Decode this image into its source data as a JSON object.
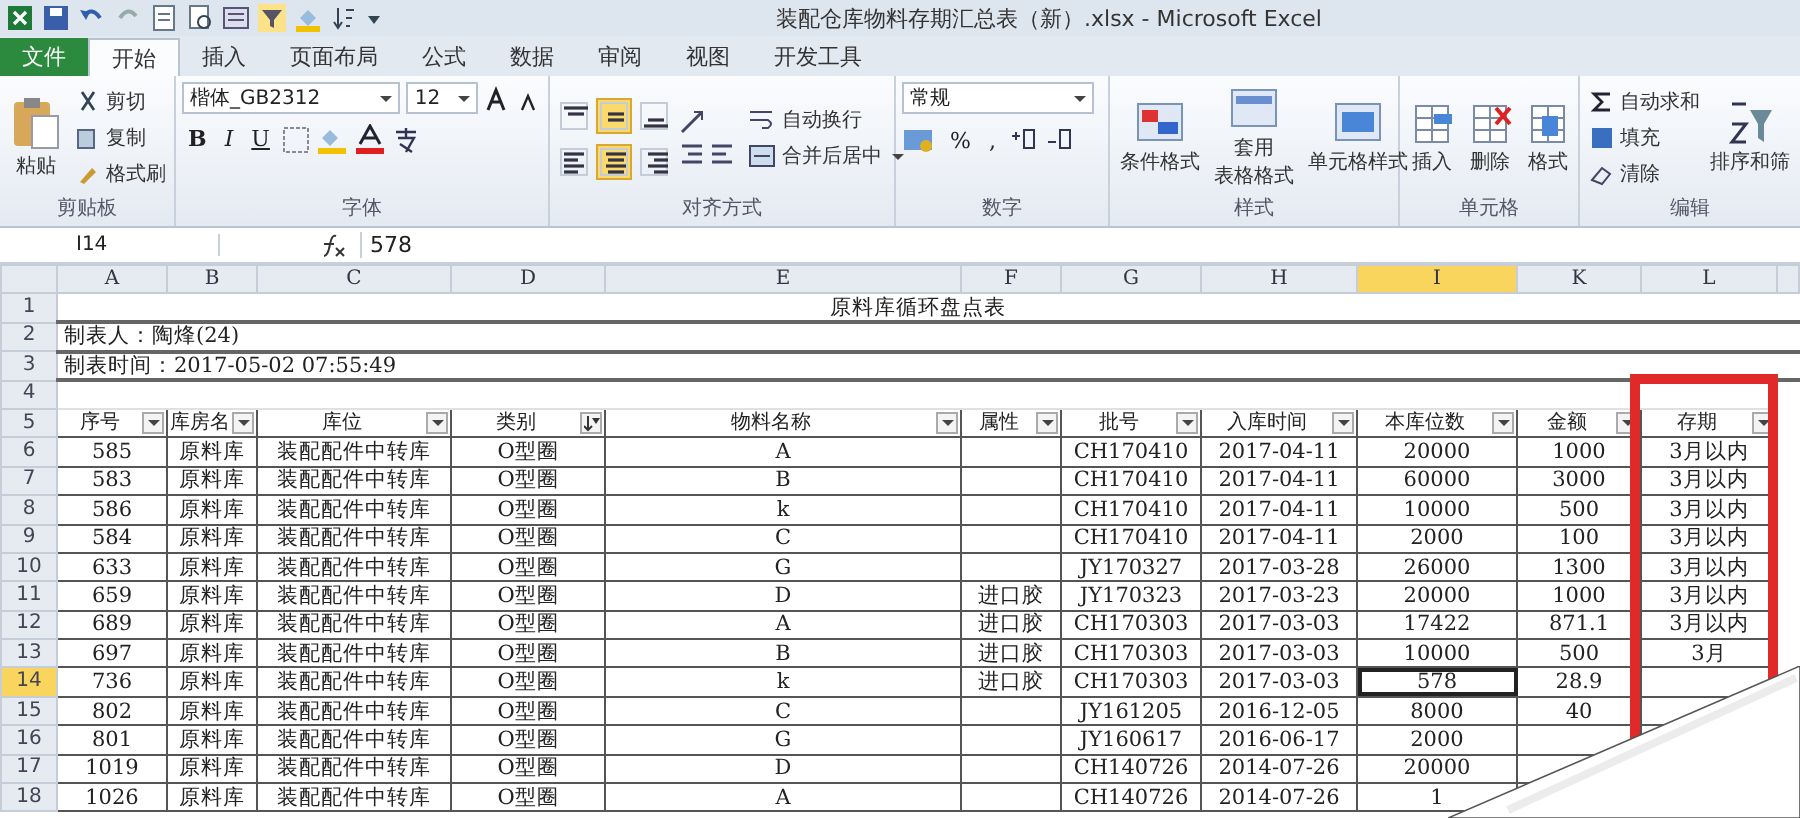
{
  "window": {
    "title": "装配仓库物料存期汇总表（新）.xlsx - Microsoft Excel"
  },
  "tabs": [
    {
      "label": "文件",
      "kind": "file",
      "selected": false
    },
    {
      "label": "开始",
      "kind": "tab",
      "selected": true
    },
    {
      "label": "插入",
      "kind": "tab",
      "selected": false
    },
    {
      "label": "页面布局",
      "kind": "tab",
      "selected": false
    },
    {
      "label": "公式",
      "kind": "tab",
      "selected": false
    },
    {
      "label": "数据",
      "kind": "tab",
      "selected": false
    },
    {
      "label": "审阅",
      "kind": "tab",
      "selected": false
    },
    {
      "label": "视图",
      "kind": "tab",
      "selected": false
    },
    {
      "label": "开发工具",
      "kind": "tab",
      "selected": false
    }
  ],
  "ribbon": {
    "clipboard": {
      "label": "剪贴板",
      "paste": "粘贴",
      "items": [
        "剪切",
        "复制",
        "格式刷"
      ]
    },
    "font": {
      "label": "字体",
      "family": "楷体_GB2312",
      "size": "12",
      "bold": "B",
      "italic": "I",
      "underline": "U"
    },
    "alignment": {
      "label": "对齐方式",
      "wrap": "自动换行",
      "merge": "合并后居中",
      "align": [
        {
          "kind": "top",
          "selected": false
        },
        {
          "kind": "middle",
          "selected": true
        },
        {
          "kind": "bottom",
          "selected": false
        },
        {
          "kind": "left",
          "selected": false
        },
        {
          "kind": "center",
          "selected": true
        },
        {
          "kind": "right",
          "selected": false
        }
      ]
    },
    "number": {
      "label": "数字",
      "format": "常规",
      "percent": "%",
      "comma": ","
    },
    "styles": {
      "label": "样式",
      "buttons": [
        [
          "条件格式"
        ],
        [
          "套用",
          "表格格式"
        ],
        [
          "单元格样式"
        ]
      ]
    },
    "cells": {
      "label": "单元格",
      "buttons": [
        "插入",
        "删除",
        "格式"
      ]
    },
    "editing": {
      "label": "编辑",
      "items": [
        "自动求和",
        "填充",
        "清除"
      ],
      "sort": "排序和筛"
    }
  },
  "formula_bar": {
    "name_box": "I14",
    "formula": "578"
  },
  "sheet": {
    "columns": [
      {
        "letter": "A",
        "selected": false
      },
      {
        "letter": "B",
        "selected": false
      },
      {
        "letter": "C",
        "selected": false
      },
      {
        "letter": "D",
        "selected": false
      },
      {
        "letter": "E",
        "selected": false
      },
      {
        "letter": "F",
        "selected": false
      },
      {
        "letter": "G",
        "selected": false
      },
      {
        "letter": "H",
        "selected": false
      },
      {
        "letter": "I",
        "selected": true
      },
      {
        "letter": "K",
        "selected": false
      },
      {
        "letter": "L",
        "selected": false
      }
    ],
    "title_row": {
      "number": "1",
      "text": "原料库循环盘点表"
    },
    "info_rows": [
      {
        "number": "2",
        "text": "制表人：陶烽(24)"
      },
      {
        "number": "3",
        "text": "制表时间：2017-05-02 07:55:49"
      }
    ],
    "blank_rows": [
      {
        "number": "4"
      }
    ],
    "header_row": {
      "number": "5",
      "cells": [
        {
          "label": "序号",
          "kind": "dropdown"
        },
        {
          "label": "库房名",
          "kind": "dropdown"
        },
        {
          "label": "库位",
          "kind": "dropdown"
        },
        {
          "label": "类别",
          "kind": "sort"
        },
        {
          "label": "物料名称",
          "kind": "dropdown"
        },
        {
          "label": "属性",
          "kind": "dropdown"
        },
        {
          "label": "批号",
          "kind": "dropdown"
        },
        {
          "label": "入库时间",
          "kind": "dropdown"
        },
        {
          "label": "本库位数",
          "kind": "dropdown"
        },
        {
          "label": "金额",
          "kind": "dropdown"
        },
        {
          "label": "存期",
          "kind": "dropdown"
        }
      ]
    },
    "rows": [
      {
        "number": "6",
        "selected": false,
        "cells": [
          "585",
          "原料库",
          "装配配件中转库",
          "O型圈",
          "A",
          null,
          "CH170410",
          "2017-04-11",
          "20000",
          "1000",
          "3月以内"
        ]
      },
      {
        "number": "7",
        "selected": false,
        "cells": [
          "583",
          "原料库",
          "装配配件中转库",
          "O型圈",
          "B",
          null,
          "CH170410",
          "2017-04-11",
          "60000",
          "3000",
          "3月以内"
        ]
      },
      {
        "number": "8",
        "selected": false,
        "cells": [
          "586",
          "原料库",
          "装配配件中转库",
          "O型圈",
          "k",
          null,
          "CH170410",
          "2017-04-11",
          "10000",
          "500",
          "3月以内"
        ]
      },
      {
        "number": "9",
        "selected": false,
        "cells": [
          "584",
          "原料库",
          "装配配件中转库",
          "O型圈",
          "C",
          null,
          "CH170410",
          "2017-04-11",
          "2000",
          "100",
          "3月以内"
        ]
      },
      {
        "number": "10",
        "selected": false,
        "cells": [
          "633",
          "原料库",
          "装配配件中转库",
          "O型圈",
          "G",
          null,
          "JY170327",
          "2017-03-28",
          "26000",
          "1300",
          "3月以内"
        ]
      },
      {
        "number": "11",
        "selected": false,
        "cells": [
          "659",
          "原料库",
          "装配配件中转库",
          "O型圈",
          "D",
          "进口胶",
          "JY170323",
          "2017-03-23",
          "20000",
          "1000",
          "3月以内"
        ]
      },
      {
        "number": "12",
        "selected": false,
        "cells": [
          "689",
          "原料库",
          "装配配件中转库",
          "O型圈",
          "A",
          "进口胶",
          "CH170303",
          "2017-03-03",
          "17422",
          "871.1",
          "3月以内"
        ]
      },
      {
        "number": "13",
        "selected": false,
        "cells": [
          "697",
          "原料库",
          "装配配件中转库",
          "O型圈",
          "B",
          "进口胶",
          "CH170303",
          "2017-03-03",
          "10000",
          "500",
          "3月"
        ]
      },
      {
        "number": "14",
        "selected": true,
        "cells": [
          "736",
          "原料库",
          "装配配件中转库",
          "O型圈",
          "k",
          "进口胶",
          "CH170303",
          "2017-03-03",
          "578",
          "28.9",
          null
        ]
      },
      {
        "number": "15",
        "selected": false,
        "cells": [
          "802",
          "原料库",
          "装配配件中转库",
          "O型圈",
          "C",
          null,
          "JY161205",
          "2016-12-05",
          "8000",
          "40",
          null
        ]
      },
      {
        "number": "16",
        "selected": false,
        "cells": [
          "801",
          "原料库",
          "装配配件中转库",
          "O型圈",
          "G",
          null,
          "JY160617",
          "2016-06-17",
          "2000",
          null,
          null
        ]
      },
      {
        "number": "17",
        "selected": false,
        "cells": [
          "1019",
          "原料库",
          "装配配件中转库",
          "O型圈",
          "D",
          null,
          "CH140726",
          "2014-07-26",
          "20000",
          null,
          null
        ]
      },
      {
        "number": "18",
        "selected": false,
        "cells": [
          "1026",
          "原料库",
          "装配配件中转库",
          "O型圈",
          "A",
          null,
          "CH140726",
          "2014-07-26",
          "1",
          null,
          null
        ]
      }
    ]
  }
}
